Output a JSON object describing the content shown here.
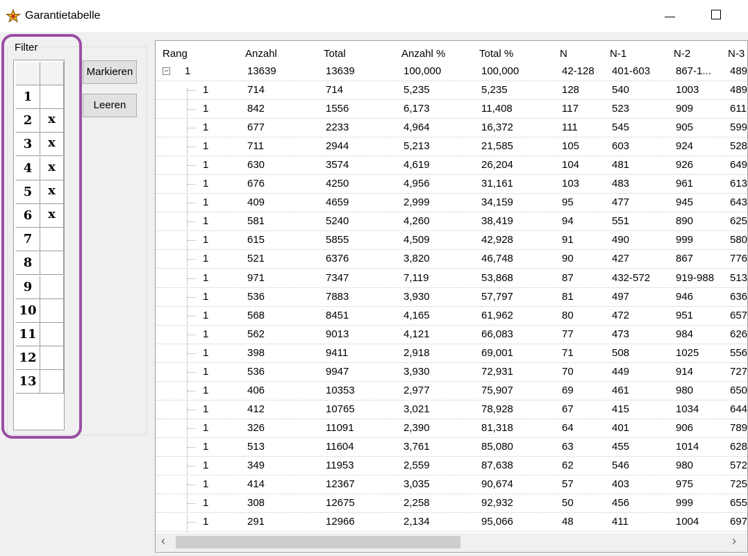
{
  "window": {
    "title": "Garantietabelle"
  },
  "filter": {
    "label": "Filter",
    "rows": [
      {
        "num": "1",
        "mark": ""
      },
      {
        "num": "2",
        "mark": "x"
      },
      {
        "num": "3",
        "mark": "x"
      },
      {
        "num": "4",
        "mark": "x"
      },
      {
        "num": "5",
        "mark": "x"
      },
      {
        "num": "6",
        "mark": "x"
      },
      {
        "num": "7",
        "mark": ""
      },
      {
        "num": "8",
        "mark": ""
      },
      {
        "num": "9",
        "mark": ""
      },
      {
        "num": "10",
        "mark": ""
      },
      {
        "num": "11",
        "mark": ""
      },
      {
        "num": "12",
        "mark": ""
      },
      {
        "num": "13",
        "mark": ""
      }
    ]
  },
  "buttons": {
    "markieren": "Markieren",
    "leeren": "Leeren"
  },
  "table": {
    "columns": [
      "Rang",
      "Anzahl",
      "Total",
      "Anzahl %",
      "Total %",
      "N",
      "N-1",
      "N-2",
      "N-3"
    ],
    "root": [
      "1",
      "13639",
      "13639",
      "100,000",
      "100,000",
      "42-128",
      "401-603",
      "867-1...",
      "489"
    ],
    "rows": [
      [
        "1",
        "714",
        "714",
        "5,235",
        "5,235",
        "128",
        "540",
        "1003",
        "489"
      ],
      [
        "1",
        "842",
        "1556",
        "6,173",
        "11,408",
        "117",
        "523",
        "909",
        "611"
      ],
      [
        "1",
        "677",
        "2233",
        "4,964",
        "16,372",
        "111",
        "545",
        "905",
        "599"
      ],
      [
        "1",
        "711",
        "2944",
        "5,213",
        "21,585",
        "105",
        "603",
        "924",
        "528"
      ],
      [
        "1",
        "630",
        "3574",
        "4,619",
        "26,204",
        "104",
        "481",
        "926",
        "649"
      ],
      [
        "1",
        "676",
        "4250",
        "4,956",
        "31,161",
        "103",
        "483",
        "961",
        "613"
      ],
      [
        "1",
        "409",
        "4659",
        "2,999",
        "34,159",
        "95",
        "477",
        "945",
        "643"
      ],
      [
        "1",
        "581",
        "5240",
        "4,260",
        "38,419",
        "94",
        "551",
        "890",
        "625"
      ],
      [
        "1",
        "615",
        "5855",
        "4,509",
        "42,928",
        "91",
        "490",
        "999",
        "580"
      ],
      [
        "1",
        "521",
        "6376",
        "3,820",
        "46,748",
        "90",
        "427",
        "867",
        "776"
      ],
      [
        "1",
        "971",
        "7347",
        "7,119",
        "53,868",
        "87",
        "432-572",
        "919-988",
        "513"
      ],
      [
        "1",
        "536",
        "7883",
        "3,930",
        "57,797",
        "81",
        "497",
        "946",
        "636"
      ],
      [
        "1",
        "568",
        "8451",
        "4,165",
        "61,962",
        "80",
        "472",
        "951",
        "657"
      ],
      [
        "1",
        "562",
        "9013",
        "4,121",
        "66,083",
        "77",
        "473",
        "984",
        "626"
      ],
      [
        "1",
        "398",
        "9411",
        "2,918",
        "69,001",
        "71",
        "508",
        "1025",
        "556"
      ],
      [
        "1",
        "536",
        "9947",
        "3,930",
        "72,931",
        "70",
        "449",
        "914",
        "727"
      ],
      [
        "1",
        "406",
        "10353",
        "2,977",
        "75,907",
        "69",
        "461",
        "980",
        "650"
      ],
      [
        "1",
        "412",
        "10765",
        "3,021",
        "78,928",
        "67",
        "415",
        "1034",
        "644"
      ],
      [
        "1",
        "326",
        "11091",
        "2,390",
        "81,318",
        "64",
        "401",
        "906",
        "789"
      ],
      [
        "1",
        "513",
        "11604",
        "3,761",
        "85,080",
        "63",
        "455",
        "1014",
        "628"
      ],
      [
        "1",
        "349",
        "11953",
        "2,559",
        "87,638",
        "62",
        "546",
        "980",
        "572"
      ],
      [
        "1",
        "414",
        "12367",
        "3,035",
        "90,674",
        "57",
        "403",
        "975",
        "725"
      ],
      [
        "1",
        "308",
        "12675",
        "2,258",
        "92,932",
        "50",
        "456",
        "999",
        "655"
      ],
      [
        "1",
        "291",
        "12966",
        "2,134",
        "95,066",
        "48",
        "411",
        "1004",
        "697"
      ]
    ]
  },
  "scrollbar": {
    "left_arrow": "‹",
    "right_arrow": "›"
  }
}
